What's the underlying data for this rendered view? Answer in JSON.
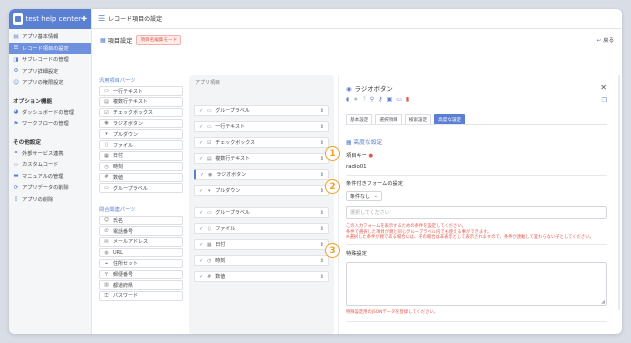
{
  "app": {
    "name": "test help center",
    "pin_icon": "pin-icon"
  },
  "topbar": {
    "title": "レコード項目の設定",
    "menu_icon": "menu-icon"
  },
  "sidebar": {
    "group1": [
      {
        "label": "アプリ基本情報",
        "icon": "info-icon"
      },
      {
        "label": "レコード項目の設定",
        "icon": "list-icon",
        "active": true
      },
      {
        "label": "サブレコードの管理",
        "icon": "subrecord-icon"
      },
      {
        "label": "アプリ詳細設定",
        "icon": "gear-icon"
      },
      {
        "label": "アプリの権限設定",
        "icon": "users-icon"
      }
    ],
    "section2": "オプション機能",
    "group2": [
      {
        "label": "ダッシュボードの管理",
        "icon": "dashboard-icon"
      },
      {
        "label": "ワークフローの管理",
        "icon": "workflow-icon"
      }
    ],
    "section3": "その他設定",
    "group3": [
      {
        "label": "外部サービス連携",
        "icon": "link-icon"
      },
      {
        "label": "カスタムコード",
        "icon": "code-icon"
      },
      {
        "label": "マニュアルの管理",
        "icon": "book-icon"
      },
      {
        "label": "アプリデータの削除",
        "icon": "refresh-icon"
      },
      {
        "label": "アプリの削除",
        "icon": "trash-icon"
      }
    ]
  },
  "header": {
    "title": "項目設定",
    "badge": "項目名編集モード",
    "back_label": "戻る"
  },
  "palette": {
    "general_title": "汎用項目パーツ",
    "general": [
      {
        "label": "一行テキスト",
        "icon": "textline-icon"
      },
      {
        "label": "複数行テキスト",
        "icon": "textarea-icon"
      },
      {
        "label": "チェックボックス",
        "icon": "checkbox-icon"
      },
      {
        "label": "ラジオボタン",
        "icon": "radio-icon"
      },
      {
        "label": "プルダウン",
        "icon": "dropdown-icon"
      },
      {
        "label": "ファイル",
        "icon": "file-icon"
      },
      {
        "label": "日付",
        "icon": "calendar-icon"
      },
      {
        "label": "時刻",
        "icon": "clock-icon"
      },
      {
        "label": "数値",
        "icon": "number-icon"
      },
      {
        "label": "グループラベル",
        "icon": "folder-icon"
      }
    ],
    "contact_title": "問合関連パーツ",
    "contact": [
      {
        "label": "氏名",
        "icon": "person-icon"
      },
      {
        "label": "電話番号",
        "icon": "phone-icon"
      },
      {
        "label": "メールアドレス",
        "icon": "mail-icon"
      },
      {
        "label": "URL",
        "icon": "globe-icon"
      },
      {
        "label": "住所セット",
        "icon": "location-icon"
      },
      {
        "label": "郵便番号",
        "icon": "postal-icon"
      },
      {
        "label": "都道府県",
        "icon": "map-icon"
      },
      {
        "label": "パスワード",
        "icon": "lock-icon"
      }
    ]
  },
  "canvas": {
    "title": "アプリ項目",
    "fields": [
      {
        "label": "グループラベル",
        "icon": "folder-icon"
      },
      {
        "label": "一行テキスト",
        "icon": "textline-icon"
      },
      {
        "label": "チェックボックス",
        "icon": "checkbox-icon"
      },
      {
        "label": "複数行テキスト",
        "icon": "textarea-icon"
      },
      {
        "label": "ラジオボタン",
        "icon": "radio-icon",
        "selected": true
      },
      {
        "label": "プルダウン",
        "icon": "dropdown-icon"
      },
      {
        "label": "グループラベル",
        "icon": "folder-icon"
      },
      {
        "label": "ファイル",
        "icon": "file-icon"
      },
      {
        "label": "日付",
        "icon": "calendar-icon"
      },
      {
        "label": "時刻",
        "icon": "clock-icon"
      },
      {
        "label": "数値",
        "icon": "number-icon"
      }
    ]
  },
  "panel": {
    "title": "ラジオボタン",
    "tabs": [
      "基本設定",
      "選択項目",
      "検索設定",
      "高度な設定"
    ],
    "active_tab": "高度な設定",
    "section_title": "高度な設定",
    "field_key_label": "項目キー",
    "field_key_value": "radio01",
    "conditional_label": "条件付きフォームの設定",
    "conditional_select": "条件なし",
    "conditional_placeholder": "選択してください",
    "notes": [
      "この入力フォームを表示するための条件を設定してください。",
      "条件で選択した項目が親と同じグループラベル内でも使える事ができます。",
      "※選択した条件が親である場合には、子の場合は非表示として表示されますので、条件が連動して変わらない子としてください。"
    ],
    "special_label": "特殊設定",
    "special_note": "特殊設定用のJSONデータを登録してください。"
  },
  "markers": [
    "1",
    "2",
    "3"
  ],
  "colors": {
    "accent": "#5b7fd1",
    "warning": "#e2574c",
    "marker": "#f0a024"
  }
}
